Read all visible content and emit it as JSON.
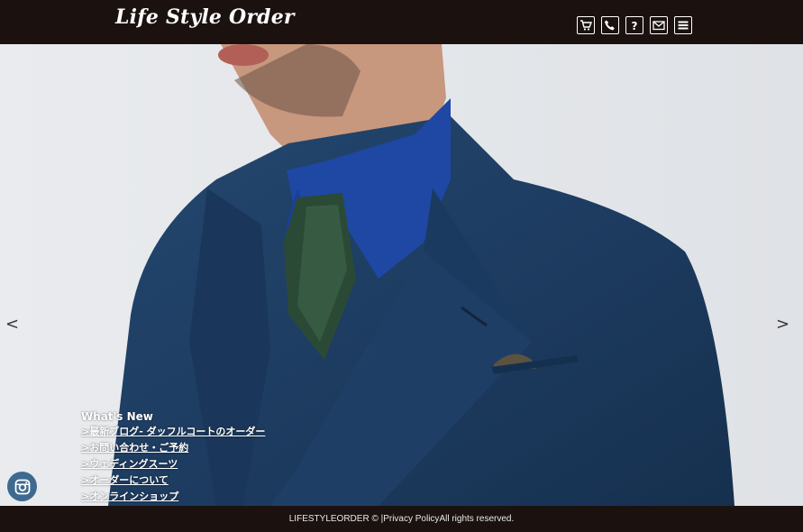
{
  "header": {
    "logo_text": "Life Style Order",
    "icons": [
      "cart-icon",
      "phone-icon",
      "help-icon",
      "mail-icon",
      "menu-icon"
    ]
  },
  "slider": {
    "prev_label": "<",
    "next_label": ">"
  },
  "news": {
    "title": "What's New",
    "links": [
      ">最新ブログ- ダッフルコートのオーダー",
      ">お問い合わせ・ご予約",
      ">ウェディングスーツ",
      ">オーダーについて",
      ">オンラインショップ"
    ]
  },
  "social": {
    "icon": "instagram-icon"
  },
  "footer": {
    "copyright": "LIFESTYLEORDER © | ",
    "privacy": "Privacy Policy",
    "rights": " All rights reserved."
  },
  "colors": {
    "header_bg": "#1b1210",
    "hero_bg": "#e4e6ea",
    "suit": "#1f3f66",
    "insta_bg": "#3e6a90"
  }
}
